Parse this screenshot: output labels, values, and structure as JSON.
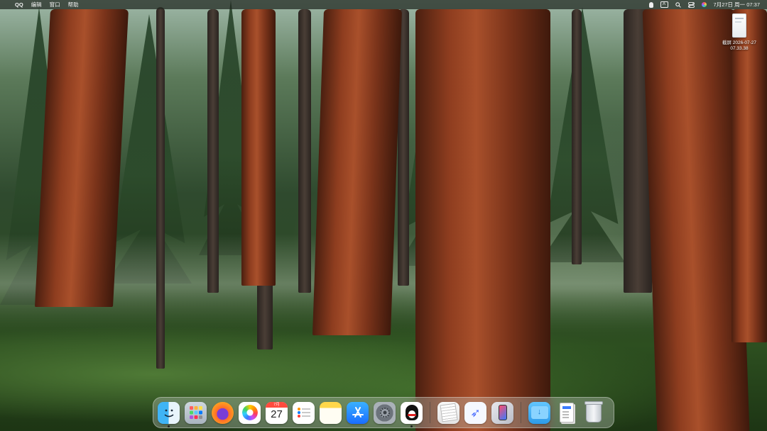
{
  "menubar": {
    "apple_glyph": "",
    "app_name": "QQ",
    "menus": [
      "编辑",
      "窗口",
      "帮助"
    ],
    "input_method": "A",
    "datetime": "7月27日 周一 07:37"
  },
  "desktop_file": {
    "label_line1": "截屏 2026-07-27",
    "label_line2": "07.33.38"
  },
  "dock": {
    "calendar_month": "7月",
    "calendar_day": "27",
    "launchpad_color": "#ff5e5e",
    "accent": "#3fb4f5"
  }
}
